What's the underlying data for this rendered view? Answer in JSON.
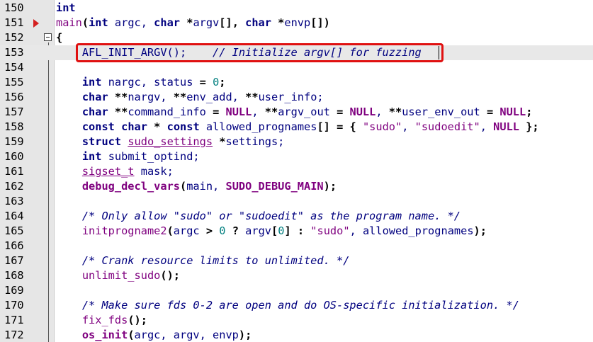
{
  "editor": {
    "lines": [
      {
        "num": "150",
        "segments": [
          {
            "t": "int",
            "c": "kw"
          }
        ]
      },
      {
        "num": "151",
        "breakpoint": true,
        "segments": [
          {
            "t": "main",
            "c": "fn"
          },
          {
            "t": "(",
            "c": "op"
          },
          {
            "t": "int",
            "c": "kw"
          },
          {
            "t": " argc, ",
            "c": "def"
          },
          {
            "t": "char",
            "c": "kw"
          },
          {
            "t": " *",
            "c": "op"
          },
          {
            "t": "argv",
            "c": "def"
          },
          {
            "t": "[], ",
            "c": "op"
          },
          {
            "t": "char",
            "c": "kw"
          },
          {
            "t": " *",
            "c": "op"
          },
          {
            "t": "envp",
            "c": "def"
          },
          {
            "t": "[])",
            "c": "op"
          }
        ]
      },
      {
        "num": "152",
        "fold": true,
        "segments": [
          {
            "t": "{",
            "c": "op"
          }
        ]
      },
      {
        "num": "153",
        "current": true,
        "segments": [
          {
            "t": "    AFL_INIT_ARGV();    ",
            "c": "def"
          },
          {
            "t": "// Initialize argv[] for fuzzing",
            "c": "cmt"
          }
        ]
      },
      {
        "num": "154",
        "segments": []
      },
      {
        "num": "155",
        "segments": [
          {
            "t": "    ",
            "c": "def"
          },
          {
            "t": "int",
            "c": "kw"
          },
          {
            "t": " nargc, status ",
            "c": "def"
          },
          {
            "t": "=",
            "c": "op"
          },
          {
            "t": " ",
            "c": "def"
          },
          {
            "t": "0",
            "c": "num"
          },
          {
            "t": ";",
            "c": "op"
          }
        ]
      },
      {
        "num": "156",
        "segments": [
          {
            "t": "    ",
            "c": "def"
          },
          {
            "t": "char",
            "c": "kw"
          },
          {
            "t": " **",
            "c": "op"
          },
          {
            "t": "nargv, ",
            "c": "def"
          },
          {
            "t": "**",
            "c": "op"
          },
          {
            "t": "env_add, ",
            "c": "def"
          },
          {
            "t": "**",
            "c": "op"
          },
          {
            "t": "user_info;",
            "c": "def"
          }
        ]
      },
      {
        "num": "157",
        "segments": [
          {
            "t": "    ",
            "c": "def"
          },
          {
            "t": "char",
            "c": "kw"
          },
          {
            "t": " **",
            "c": "op"
          },
          {
            "t": "command_info ",
            "c": "def"
          },
          {
            "t": "=",
            "c": "op"
          },
          {
            "t": " ",
            "c": "def"
          },
          {
            "t": "NULL",
            "c": "mac"
          },
          {
            "t": ", ",
            "c": "def"
          },
          {
            "t": "**",
            "c": "op"
          },
          {
            "t": "argv_out ",
            "c": "def"
          },
          {
            "t": "=",
            "c": "op"
          },
          {
            "t": " ",
            "c": "def"
          },
          {
            "t": "NULL",
            "c": "mac"
          },
          {
            "t": ", ",
            "c": "def"
          },
          {
            "t": "**",
            "c": "op"
          },
          {
            "t": "user_env_out ",
            "c": "def"
          },
          {
            "t": "=",
            "c": "op"
          },
          {
            "t": " ",
            "c": "def"
          },
          {
            "t": "NULL",
            "c": "mac"
          },
          {
            "t": ";",
            "c": "op"
          }
        ]
      },
      {
        "num": "158",
        "segments": [
          {
            "t": "    ",
            "c": "def"
          },
          {
            "t": "const",
            "c": "kw"
          },
          {
            "t": " ",
            "c": "def"
          },
          {
            "t": "char",
            "c": "kw"
          },
          {
            "t": " * ",
            "c": "op"
          },
          {
            "t": "const",
            "c": "kw"
          },
          {
            "t": " allowed_prognames",
            "c": "def"
          },
          {
            "t": "[] = {",
            "c": "op"
          },
          {
            "t": " ",
            "c": "def"
          },
          {
            "t": "\"sudo\"",
            "c": "str"
          },
          {
            "t": ", ",
            "c": "def"
          },
          {
            "t": "\"sudoedit\"",
            "c": "str"
          },
          {
            "t": ", ",
            "c": "def"
          },
          {
            "t": "NULL",
            "c": "mac"
          },
          {
            "t": " };",
            "c": "op"
          }
        ]
      },
      {
        "num": "159",
        "segments": [
          {
            "t": "    ",
            "c": "def"
          },
          {
            "t": "struct",
            "c": "kw"
          },
          {
            "t": " ",
            "c": "def"
          },
          {
            "t": "sudo_settings",
            "c": "fn ul"
          },
          {
            "t": " *",
            "c": "op"
          },
          {
            "t": "settings;",
            "c": "def"
          }
        ]
      },
      {
        "num": "160",
        "segments": [
          {
            "t": "    ",
            "c": "def"
          },
          {
            "t": "int",
            "c": "kw"
          },
          {
            "t": " submit_optind;",
            "c": "def"
          }
        ]
      },
      {
        "num": "161",
        "segments": [
          {
            "t": "    ",
            "c": "def"
          },
          {
            "t": "sigset_t",
            "c": "fn ul"
          },
          {
            "t": " mask;",
            "c": "def"
          }
        ]
      },
      {
        "num": "162",
        "segments": [
          {
            "t": "    ",
            "c": "def"
          },
          {
            "t": "debug_decl_vars",
            "c": "fnb"
          },
          {
            "t": "(",
            "c": "op"
          },
          {
            "t": "main, ",
            "c": "def"
          },
          {
            "t": "SUDO_DEBUG_MAIN",
            "c": "mac"
          },
          {
            "t": ");",
            "c": "op"
          }
        ]
      },
      {
        "num": "163",
        "segments": []
      },
      {
        "num": "164",
        "segments": [
          {
            "t": "    ",
            "c": "def"
          },
          {
            "t": "/* Only allow \"sudo\" or \"sudoedit\" as the program name. */",
            "c": "cmt"
          }
        ]
      },
      {
        "num": "165",
        "segments": [
          {
            "t": "    ",
            "c": "def"
          },
          {
            "t": "initprogname2",
            "c": "fn"
          },
          {
            "t": "(",
            "c": "op"
          },
          {
            "t": "argc ",
            "c": "def"
          },
          {
            "t": ">",
            "c": "op"
          },
          {
            "t": " ",
            "c": "def"
          },
          {
            "t": "0",
            "c": "num"
          },
          {
            "t": " ? ",
            "c": "op"
          },
          {
            "t": "argv",
            "c": "def"
          },
          {
            "t": "[",
            "c": "op"
          },
          {
            "t": "0",
            "c": "num"
          },
          {
            "t": "] : ",
            "c": "op"
          },
          {
            "t": "\"sudo\"",
            "c": "str"
          },
          {
            "t": ", allowed_prognames",
            "c": "def"
          },
          {
            "t": ");",
            "c": "op"
          }
        ]
      },
      {
        "num": "166",
        "segments": []
      },
      {
        "num": "167",
        "segments": [
          {
            "t": "    ",
            "c": "def"
          },
          {
            "t": "/* Crank resource limits to unlimited. */",
            "c": "cmt"
          }
        ]
      },
      {
        "num": "168",
        "segments": [
          {
            "t": "    ",
            "c": "def"
          },
          {
            "t": "unlimit_sudo",
            "c": "fn"
          },
          {
            "t": "();",
            "c": "op"
          }
        ]
      },
      {
        "num": "169",
        "segments": []
      },
      {
        "num": "170",
        "segments": [
          {
            "t": "    ",
            "c": "def"
          },
          {
            "t": "/* Make sure fds 0-2 are open and do OS-specific initialization. */",
            "c": "cmt"
          }
        ]
      },
      {
        "num": "171",
        "segments": [
          {
            "t": "    ",
            "c": "def"
          },
          {
            "t": "fix_fds",
            "c": "fn"
          },
          {
            "t": "();",
            "c": "op"
          }
        ]
      },
      {
        "num": "172",
        "segments": [
          {
            "t": "    ",
            "c": "def"
          },
          {
            "t": "os_init",
            "c": "fnb"
          },
          {
            "t": "(",
            "c": "op"
          },
          {
            "t": "argc, argv, envp",
            "c": "def"
          },
          {
            "t": ");",
            "c": "op"
          }
        ]
      }
    ]
  },
  "colors": {
    "highlight_box": "#e01010",
    "breakpoint": "#d42020",
    "keyword": "#00007f",
    "string": "#7f007f",
    "number": "#007f7f",
    "current_line_bg": "#e8e8e8"
  },
  "icons": {
    "breakpoint": "breakpoint-arrow-icon",
    "fold": "fold-minus-icon"
  }
}
